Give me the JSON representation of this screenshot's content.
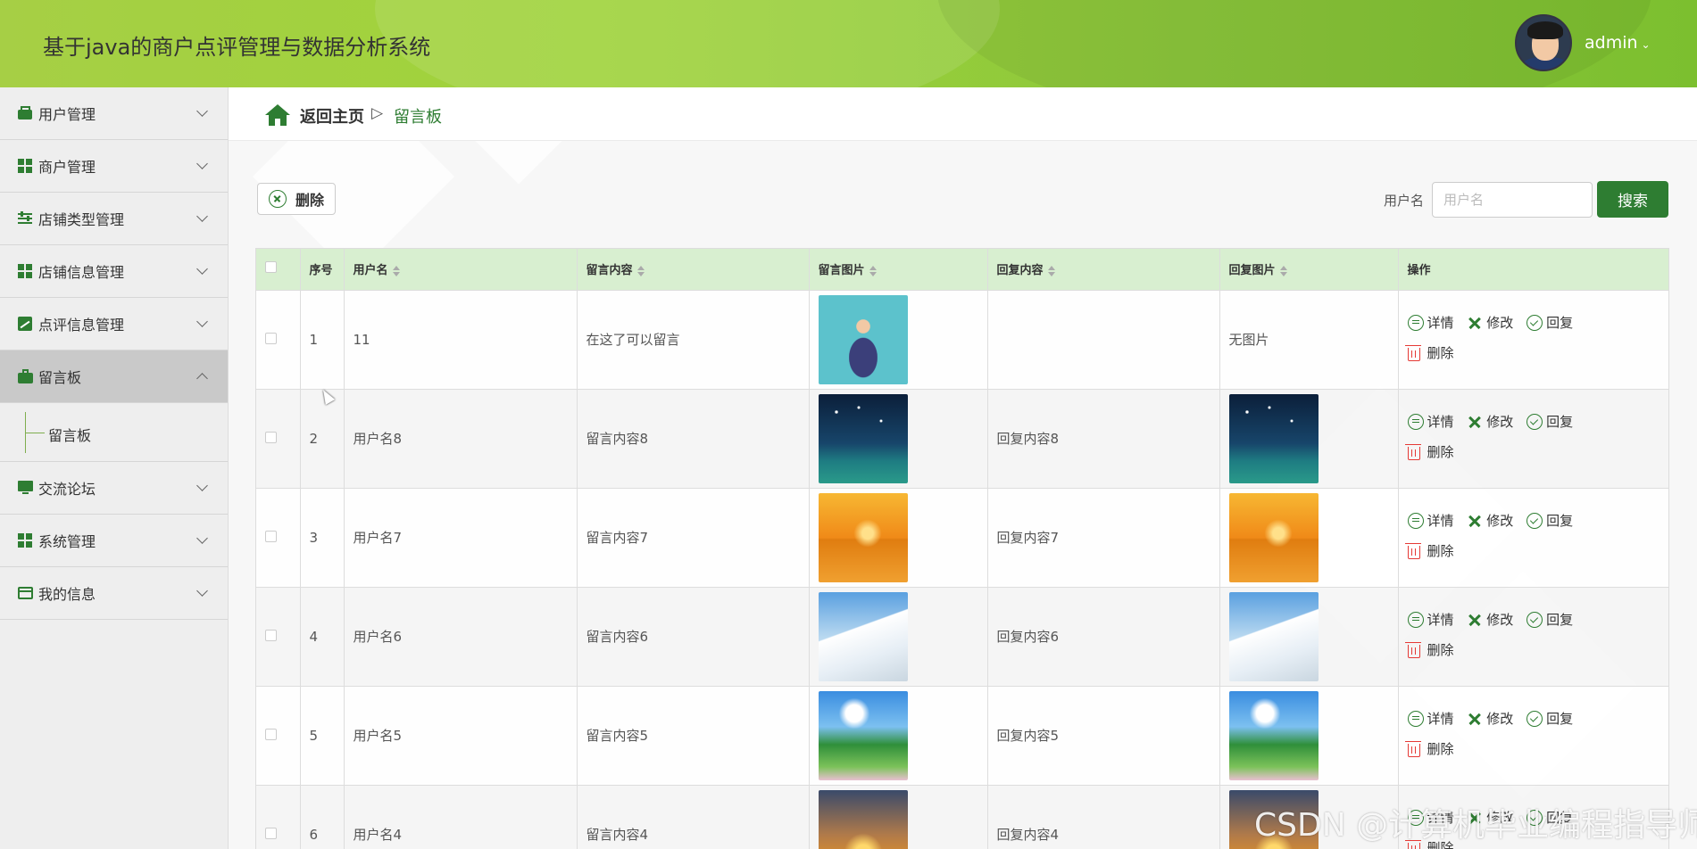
{
  "header": {
    "title": "基于java的商户点评管理与数据分析系统",
    "username": "admin"
  },
  "sidebar": {
    "items": [
      {
        "label": "用户管理",
        "icon": "wallet-icon"
      },
      {
        "label": "商户管理",
        "icon": "grid-icon"
      },
      {
        "label": "店铺类型管理",
        "icon": "sliders-icon"
      },
      {
        "label": "店铺信息管理",
        "icon": "grid-icon"
      },
      {
        "label": "点评信息管理",
        "icon": "chart-icon"
      },
      {
        "label": "留言板",
        "icon": "briefcase-icon",
        "active": true
      },
      {
        "label": "交流论坛",
        "icon": "monitor-icon"
      },
      {
        "label": "系统管理",
        "icon": "grid-icon"
      },
      {
        "label": "我的信息",
        "icon": "card-icon"
      }
    ],
    "submenu_label": "留言板"
  },
  "breadcrumb": {
    "home": "返回主页",
    "separator": "▷",
    "current": "留言板"
  },
  "toolbar": {
    "delete_label": "删除",
    "search_label": "用户名",
    "search_placeholder": "用户名",
    "search_button": "搜索"
  },
  "table": {
    "headers": [
      "序号",
      "用户名",
      "留言内容",
      "留言图片",
      "回复内容",
      "回复图片",
      "操作"
    ],
    "actions": {
      "detail": "详情",
      "edit": "修改",
      "reply": "回复",
      "delete": "删除"
    },
    "rows": [
      {
        "index": "1",
        "username": "11",
        "content": "在这了可以留言",
        "image": "busy-man",
        "reply": "",
        "reply_image": "无图片"
      },
      {
        "index": "2",
        "username": "用户名8",
        "content": "留言内容8",
        "image": "starry-night",
        "reply": "回复内容8",
        "reply_image": "starry-night"
      },
      {
        "index": "3",
        "username": "用户名7",
        "content": "留言内容7",
        "image": "sunset-lake",
        "reply": "回复内容7",
        "reply_image": "sunset-lake"
      },
      {
        "index": "4",
        "username": "用户名6",
        "content": "留言内容6",
        "image": "snow-mountain",
        "reply": "回复内容6",
        "reply_image": "snow-mountain"
      },
      {
        "index": "5",
        "username": "用户名5",
        "content": "留言内容5",
        "image": "spring-meadow",
        "reply": "回复内容5",
        "reply_image": "spring-meadow"
      },
      {
        "index": "6",
        "username": "用户名4",
        "content": "留言内容4",
        "image": "grass-sunset",
        "reply": "回复内容4",
        "reply_image": "grass-sunset"
      }
    ]
  },
  "watermark": "CSDN @计算机毕业编程指导师",
  "colors": {
    "accent": "#2e7d32",
    "header_green": "#9fd33a",
    "danger": "#e53935",
    "table_header": "#d8efd0"
  }
}
